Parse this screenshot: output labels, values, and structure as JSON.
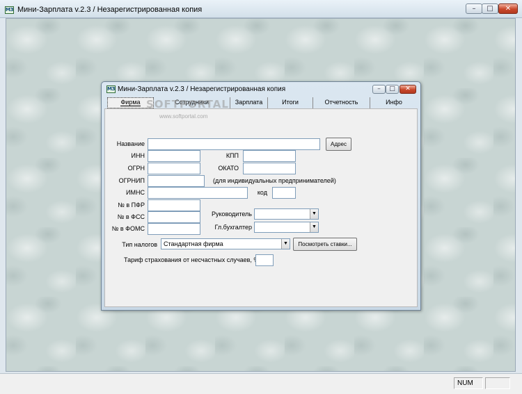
{
  "app": {
    "icon_text": "МЗ",
    "title": "Мини-Зарплата v.2.3 / Незарегистрированная копия"
  },
  "window_buttons": {
    "minimize": "–",
    "maximize": "□",
    "close": "✕"
  },
  "child_window": {
    "title": "Мини-Зарплата v.2.3 / Незарегистрированная копия"
  },
  "tabs": [
    {
      "label": "Фирма"
    },
    {
      "label": "Сотрудники"
    },
    {
      "label": "Зарплата"
    },
    {
      "label": "Итоги"
    },
    {
      "label": "Отчетность"
    },
    {
      "label": "Инфо"
    }
  ],
  "watermark": {
    "brand": "SOFTPORTAL",
    "url": "www.softportal.com"
  },
  "form": {
    "name_label": "Название",
    "address_button": "Адрес",
    "inn_label": "ИНН",
    "kpp_label": "КПП",
    "ogrn_label": "ОГРН",
    "okato_label": "ОКАТО",
    "ogrnip_label": "ОГРНИП",
    "ogrnip_note": "(для индивидуальных предпринимателей)",
    "imns_label": "ИМНС",
    "code_label": "код",
    "pfr_label": "№ в ПФР",
    "fss_label": "№ в ФСС",
    "foms_label": "№ в ФОМС",
    "director_label": "Руководитель",
    "accountant_label": "Гл.бухгалтер",
    "tax_type_label": "Тип налогов",
    "tax_type_value": "Стандартная фирма",
    "view_rates_button": "Посмотреть ставки...",
    "insurance_rate_label": "Тариф страхования от несчастных случаев, %"
  },
  "status_bar": {
    "num_indicator": "NUM"
  }
}
